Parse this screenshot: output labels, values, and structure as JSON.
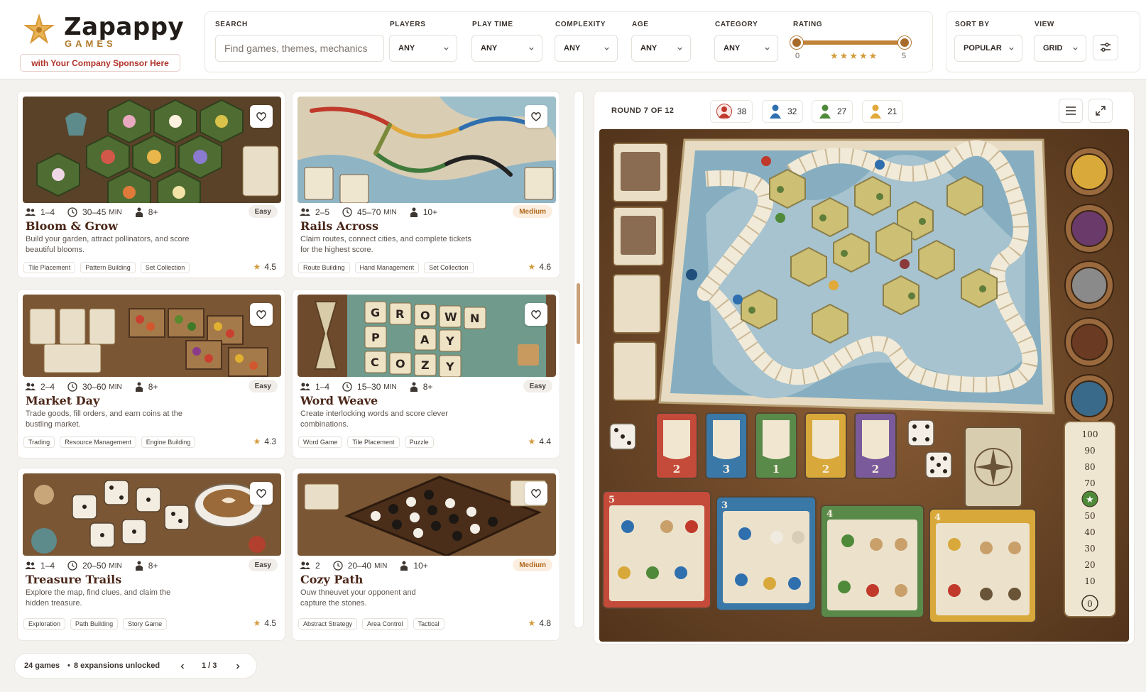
{
  "brand": {
    "name": "Zapappy",
    "subtitle": "GAMES",
    "sponsor": "with Your Company Sponsor Here"
  },
  "filters": {
    "search": {
      "label": "SEARCH",
      "placeholder": "Find games, themes, mechanics"
    },
    "players": {
      "label": "PLAYERS",
      "value": "ANY"
    },
    "play_time": {
      "label": "PLAY TIME",
      "value": "ANY"
    },
    "complexity": {
      "label": "COMPLEXITY",
      "value": "ANY"
    },
    "age": {
      "label": "AGE",
      "value": "ANY"
    },
    "category": {
      "label": "CATEGORY",
      "value": "ANY"
    },
    "rating": {
      "label": "RATING",
      "min": "0",
      "max": "5",
      "range_low": 0,
      "range_high": 5
    }
  },
  "sort": {
    "sort_label": "SORT BY",
    "sort_value": "POPULAR",
    "view_label": "VIEW",
    "view_value": "GRID"
  },
  "min_unit": "MIN",
  "games": [
    {
      "title": "Bloom & Grow",
      "players": "1–4",
      "time": "30–45",
      "age": "8+",
      "level": "Easy",
      "desc": "Build your garden, attract pollinators, and score beautiful blooms.",
      "tags": [
        "Tile Placement",
        "Pattern Building",
        "Set Collection"
      ],
      "rating": "4.5"
    },
    {
      "title": "Rails Across",
      "players": "2–5",
      "time": "45–70",
      "age": "10+",
      "level": "Medium",
      "desc": "Claim routes, connect cities, and complete tickets for the highest score.",
      "tags": [
        "Route Building",
        "Hand Management",
        "Set Collection"
      ],
      "rating": "4.6"
    },
    {
      "title": "Market Day",
      "players": "2–4",
      "time": "30–60",
      "age": "8+",
      "level": "Easy",
      "desc": "Trade goods, fill orders, and earn coins at the bustling market.",
      "tags": [
        "Trading",
        "Resource Management",
        "Engine Building"
      ],
      "rating": "4.3"
    },
    {
      "title": "Word Weave",
      "players": "1–4",
      "time": "15–30",
      "age": "8+",
      "level": "Easy",
      "desc": "Create interlocking words and score clever combinations.",
      "tags": [
        "Word Game",
        "Tile Placement",
        "Puzzle"
      ],
      "rating": "4.4"
    },
    {
      "title": "Treasure Trails",
      "players": "1–4",
      "time": "20–50",
      "age": "8+",
      "level": "Easy",
      "desc": "Explore the map, find clues, and claim the hidden treasure.",
      "tags": [
        "Exploration",
        "Path Building",
        "Story Game"
      ],
      "rating": "4.5"
    },
    {
      "title": "Cozy Path",
      "players": "2",
      "time": "20–40",
      "age": "10+",
      "level": "Medium",
      "desc": "Ouw thneuvet your opponent and capture the stones.",
      "tags": [
        "Abstract Strategy",
        "Area Control",
        "Tactical"
      ],
      "rating": "4.8"
    }
  ],
  "footer": {
    "count": "24 games",
    "separator": "•",
    "expansions": "8 expansions unlocked",
    "page": "1 / 3"
  },
  "board": {
    "round": "ROUND 7 OF 12",
    "players": [
      {
        "color": "#c0392b",
        "score": "38"
      },
      {
        "color": "#2f6fae",
        "score": "32"
      },
      {
        "color": "#4f8a3a",
        "score": "27"
      },
      {
        "color": "#e0a93a",
        "score": "21"
      }
    ],
    "cards": [
      "2",
      "3",
      "1",
      "2",
      "2"
    ],
    "mats": [
      "5",
      "3",
      "4",
      "4"
    ],
    "score_track": [
      "100",
      "90",
      "80",
      "70",
      "",
      "50",
      "40",
      "30",
      "20",
      "10",
      "0"
    ]
  },
  "colors": {
    "accent": "#b07a2c",
    "title": "#4a2618",
    "sponsor": "#b0322a",
    "star": "#d29b3c"
  }
}
